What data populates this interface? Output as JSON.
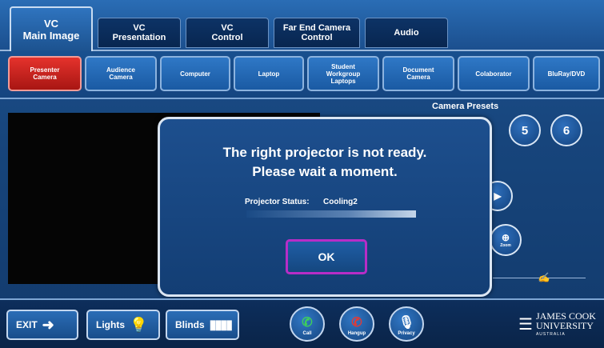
{
  "tabs": [
    {
      "label": "VC\nMain Image",
      "active": true
    },
    {
      "label": "VC\nPresentation"
    },
    {
      "label": "VC\nControl"
    },
    {
      "label": "Far End Camera\nControl"
    },
    {
      "label": "Audio"
    }
  ],
  "sources": [
    {
      "label": "Presenter\nCamera",
      "active": true
    },
    {
      "label": "Audience\nCamera"
    },
    {
      "label": "Computer"
    },
    {
      "label": "Laptop"
    },
    {
      "label": "Student\nWorkgroup\nLaptops"
    },
    {
      "label": "Document\nCamera"
    },
    {
      "label": "Colaborator"
    },
    {
      "label": "BluRay/DVD"
    }
  ],
  "camera_presets": {
    "title": "Camera Presets",
    "visible_presets": [
      "5",
      "6"
    ]
  },
  "zoom_label": "Zoom",
  "modal": {
    "line1": "The right projector is not ready.",
    "line2": "Please wait a moment.",
    "status_label": "Projector Status:",
    "status_value": "Cooling2",
    "ok_label": "OK",
    "progress_fraction": 0.5
  },
  "bottom": {
    "exit": "EXIT",
    "lights": "Lights",
    "blinds": "Blinds",
    "call": "Call",
    "hangup": "Hangup",
    "privacy": "Privacy"
  },
  "logo": {
    "line1": "JAMES COOK",
    "line2": "UNIVERSITY",
    "line3": "AUSTRALIA"
  },
  "colors": {
    "active_source": "#c81e1a",
    "ok_border": "#b72dc7",
    "panel_blue": "#1d4f8e"
  }
}
